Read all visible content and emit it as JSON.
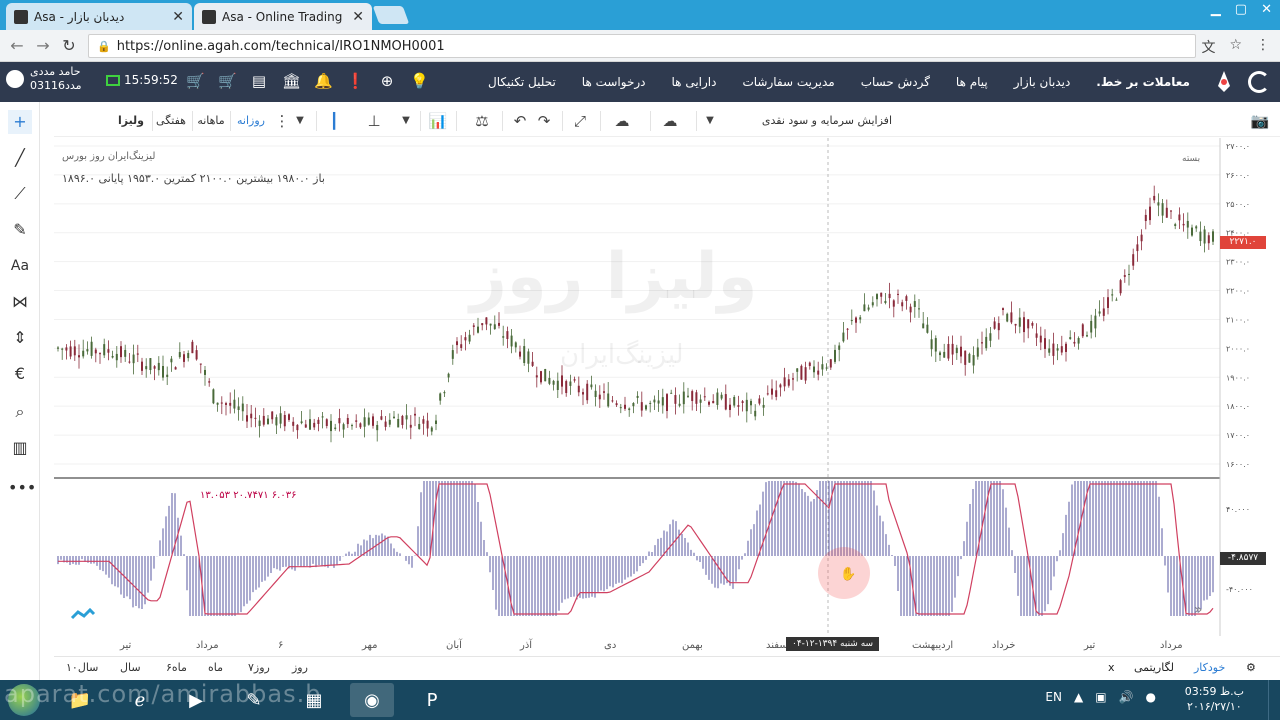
{
  "browser": {
    "tabs": [
      {
        "label": "Asa - دیدبان بازار",
        "active": false
      },
      {
        "label": "Asa - Online Trading",
        "active": true
      }
    ],
    "url": "https://online.agah.com/technical/IRO1NMOH0001"
  },
  "header": {
    "user_name": "حامد مددی",
    "user_code": "مدد03116",
    "clock": "15:59:52",
    "nav": [
      "معاملات بر خط.",
      "دیدبان بازار",
      "پیام ها",
      "گردش حساب",
      "مدیریت سفارشات",
      "دارایی ها",
      "درخواست ها",
      "تحلیل تکنیکال"
    ]
  },
  "toolbar": {
    "symbol": "ولیزا",
    "weekly": "هفتگی",
    "monthly": "ماهانه",
    "daily": "روزانه",
    "indicator_dropdown": "افزایش سرمایه و سود نقدی"
  },
  "chart_header": {
    "title": "لیزینگ‌ایران روز بورس",
    "ohlc_text": "باز ۱۹۸۰.۰ بیشترین ۲۱۰۰.۰ کمترین ۱۹۵۳.۰ پایانی ۱۸۹۶.۰",
    "macd_text": "۱۳.۰۵۳ ۲۰.۷۴۷۱ ۶.۰۳۶",
    "last_price_tag": "۲۲۷۱.۰",
    "macd_tag": "-۴.۸۵۷۷",
    "legend_label": "بسته",
    "watermark": "ولیزا روز",
    "watermark_sub": "لیزینگ‌ایران"
  },
  "chart_data": {
    "type": "candlestick",
    "price_axis": [
      "۲۷۰۰.۰",
      "۲۶۰۰.۰",
      "۲۵۰۰.۰",
      "۲۴۰۰.۰",
      "۲۳۰۰.۰",
      "۲۲۰۰.۰",
      "۲۱۰۰.۰",
      "۲۰۰۰.۰",
      "۱۹۰۰.۰",
      "۱۸۰۰.۰",
      "۱۷۰۰.۰",
      "۱۶۰۰.۰"
    ],
    "macd_axis": [
      "۴۰.۰۰۰",
      "-۴۰.۰۰۰"
    ],
    "time_labels": [
      "تیر",
      "مرداد",
      "۶",
      "مهر",
      "آبان",
      "آذر",
      "دی",
      "بهمن",
      "اسفند",
      "اردیبهشت",
      "خرداد",
      "تیر",
      "مرداد"
    ],
    "date_tip": "سه شنبه ۱۳۹۴-۱۲-۰۴",
    "ylim": [
      1600,
      2700
    ]
  },
  "range_bar": {
    "left": [
      "سال۱۰",
      "سال",
      "ماه۶",
      "ماه",
      "روز۷",
      "روز"
    ],
    "right": [
      "خودکار",
      "لگاریتمی",
      "x"
    ]
  },
  "taskbar": {
    "lang": "EN",
    "time": "03:59 ب.ظ",
    "date": "۲۰۱۶/۲۷/۱۰",
    "watermark": "aparat.com/amirabbas.b"
  },
  "colors": {
    "tabstrip": "#2a9fd6",
    "app_header": "#2f3a4f",
    "candle_up": "#4a6a3a",
    "candle_down": "#8a2a3a",
    "macd_bar": "#2d2d8a",
    "signal_line": "#d04060",
    "accent": "#2b7cd3"
  }
}
